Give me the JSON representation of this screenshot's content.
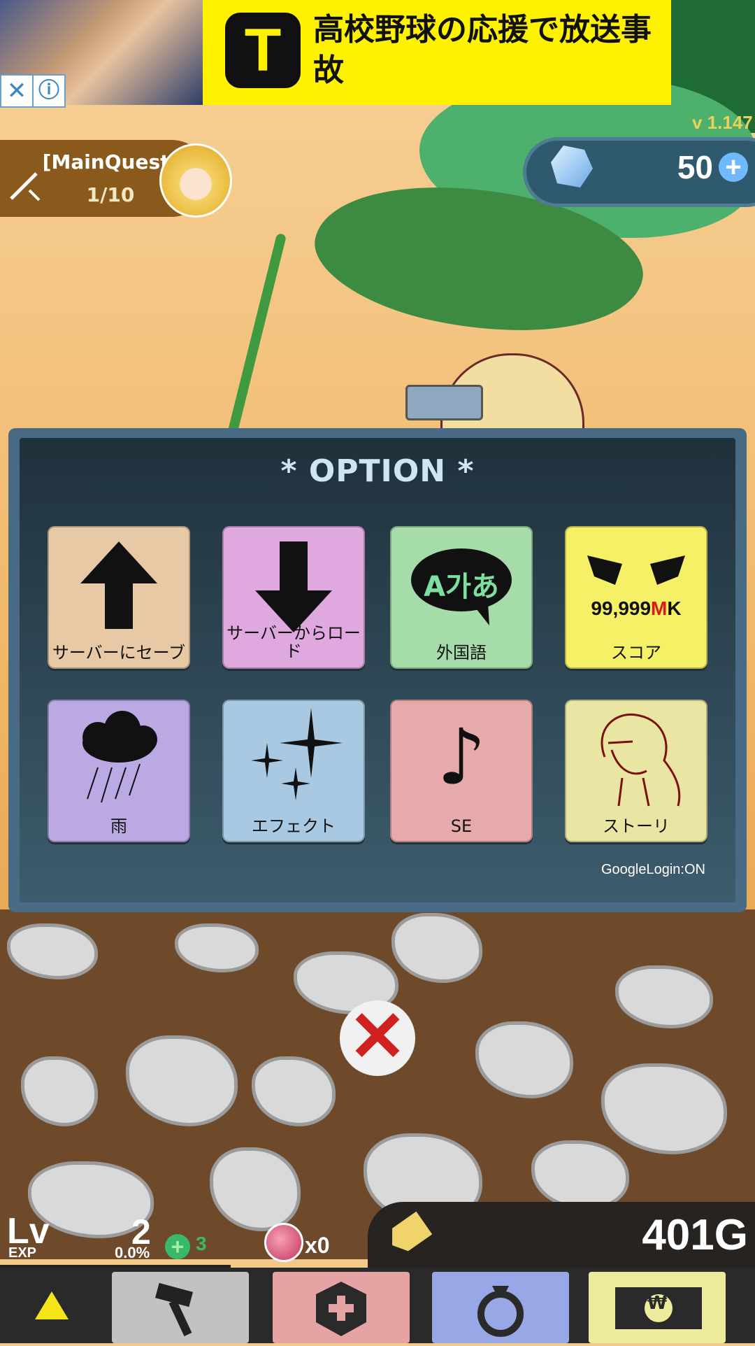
{
  "ad": {
    "logo_letter": "T",
    "headline": "高校野球の応援で放送事故",
    "close_glyph": "✕",
    "info_glyph": "ⓘ"
  },
  "version": "v 1.147",
  "quest": {
    "title": "[MainQuest]",
    "progress": "1/10"
  },
  "gems": {
    "count": "50",
    "plus_glyph": "+"
  },
  "option": {
    "title": "* OPTION *",
    "items": [
      {
        "label": "サーバーにセーブ",
        "color": "#e7c9a6",
        "icon": "arrow-up-icon"
      },
      {
        "label": "サーバーからロード",
        "color": "#dfa9df",
        "icon": "arrow-down-icon"
      },
      {
        "label": "外国語",
        "color": "#a6dcaa",
        "icon": "speech-bubble-icon",
        "icon_text": "A가あ"
      },
      {
        "label": "スコア",
        "color": "#f5f066",
        "icon": "wings-score-icon",
        "icon_text_black": "99,999",
        "icon_text_red": "M",
        "icon_text_tail": "K"
      },
      {
        "label": "雨",
        "color": "#bba9e3",
        "icon": "rain-cloud-icon"
      },
      {
        "label": "エフェクト",
        "color": "#a9c9e2",
        "icon": "sparkles-icon"
      },
      {
        "label": "SE",
        "color": "#e7aaaa",
        "icon": "music-note-icon",
        "icon_text": "♪"
      },
      {
        "label": "ストーリ",
        "color": "#e8e6a2",
        "icon": "character-sketch-icon"
      }
    ],
    "google_login": "GoogleLogin:ON",
    "close_glyph": "✕"
  },
  "status": {
    "lv_label": "Lv",
    "exp_label": "EXP",
    "level": "2",
    "exp_percent": "0.0%",
    "plus_glyph": "+",
    "plus_count": "3",
    "potion_count": "x0",
    "gold": "401G"
  },
  "nav": {
    "money_symbol": "₩"
  }
}
